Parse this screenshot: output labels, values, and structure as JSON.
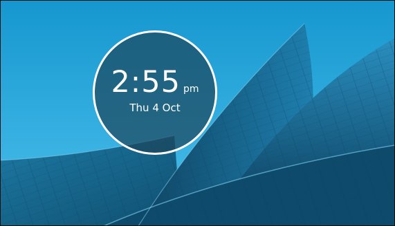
{
  "lock_screen": {
    "time": "2:55",
    "ampm": "pm",
    "date": "Thu 4 Oct"
  },
  "wallpaper": {
    "subject": "",
    "sky_color": "#1a9fd4",
    "panel_color": "#1a6b92"
  }
}
